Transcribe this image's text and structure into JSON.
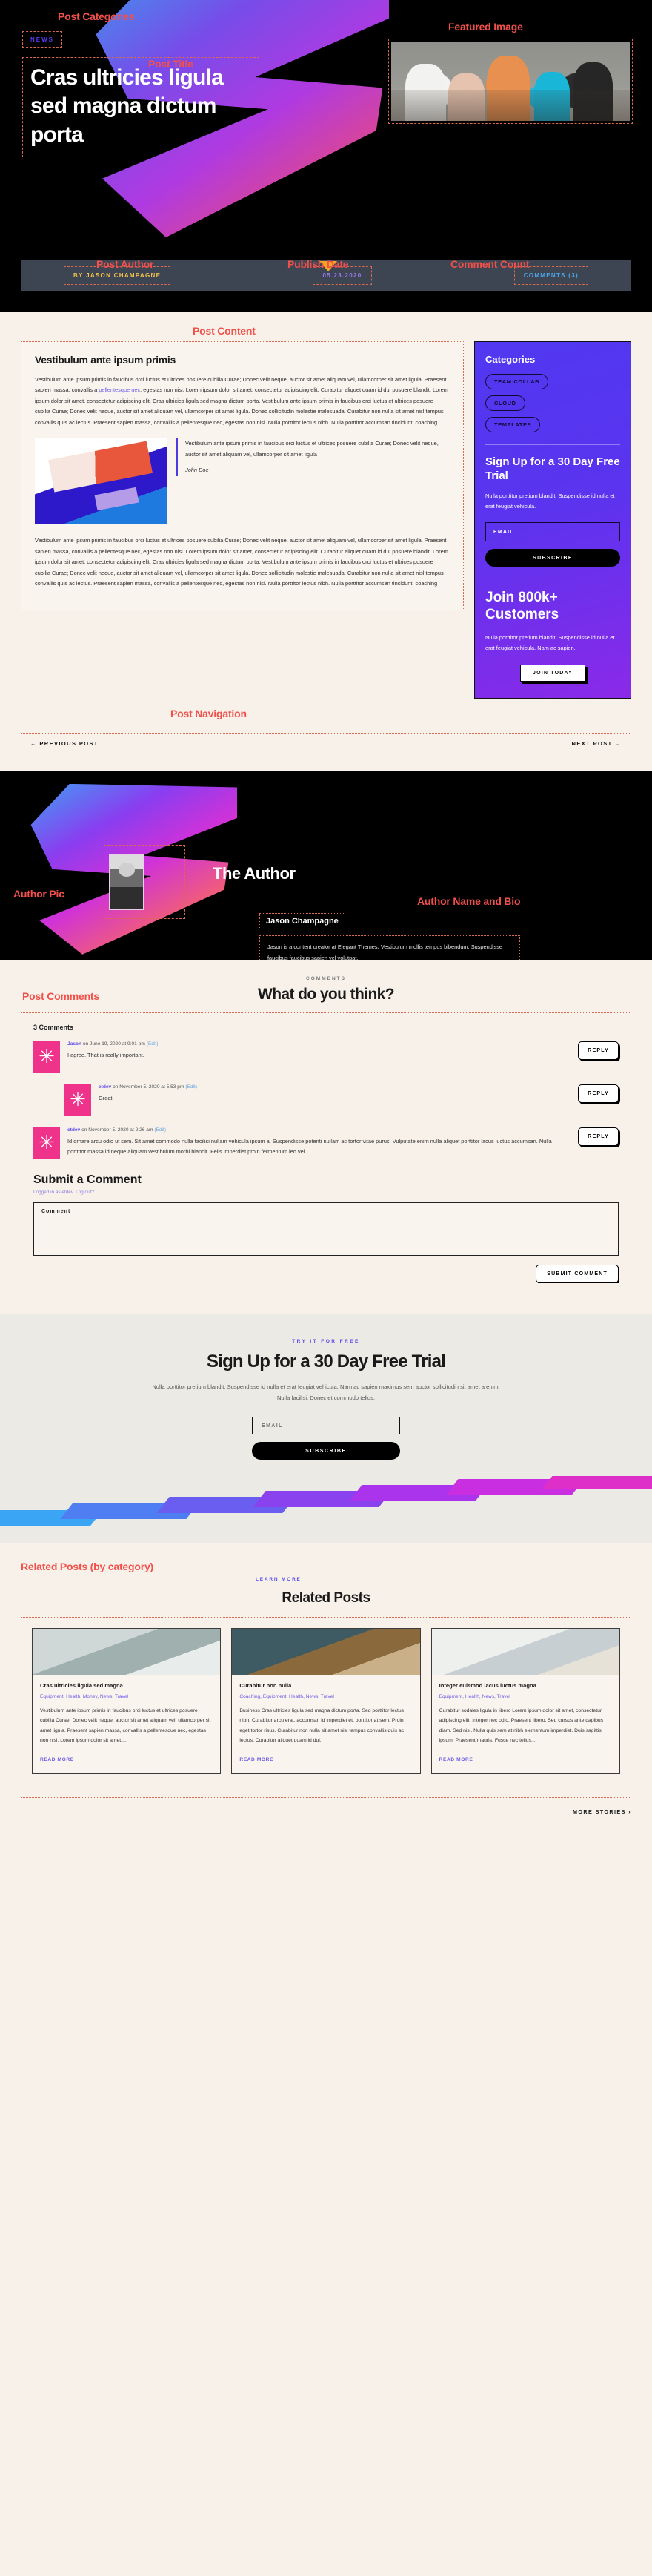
{
  "annotations": {
    "post_categories": "Post Categories",
    "post_title": "Post Title",
    "featured_image": "Featured Image",
    "post_author": "Post Author",
    "publish_date": "Publish Date",
    "comment_count": "Comment Count",
    "post_content": "Post Content",
    "post_navigation": "Post Navigation",
    "author_pic": "Author Pic",
    "author_name_bio": "Author Name and Bio",
    "post_comments": "Post Comments",
    "related_posts": "Related Posts (by category)"
  },
  "hero": {
    "category": "NEWS",
    "title": "Cras ultricies ligula sed magna dictum porta"
  },
  "meta": {
    "author": "BY JASON CHAMPAGNE",
    "date": "05.23.2020",
    "comments": "COMMENTS (3)"
  },
  "post": {
    "heading": "Vestibulum ante ipsum primis",
    "paragraph1_a": "Vestibulum ante ipsum primis in faucibus orci luctus et ultrices posuere cubilia Curae; Donec velit neque, auctor sit amet aliquam vel, ullamcorper sit amet ligula. Praesent sapien massa, convallis a ",
    "paragraph1_link": "pellentesque nec",
    "paragraph1_b": ", egestas non nisi. Lorem ipsum dolor sit amet, consectetur adipiscing elit. Curabitur aliquet quam id dui posuere blandit. Lorem ipsum dolor sit amet, consectetur adipiscing elit. Cras ultricies ligula sed magna dictum porta. Vestibulum ante ipsum primis in faucibus orci luctus et ultrices posuere cubilia Curae; Donec velit neque, auctor sit amet aliquam vel, ullamcorper sit amet ligula. Donec sollicitudin molestie malesuada. Curabitur non nulla sit amet nisl tempus convallis quis ac lectus. Praesent sapien massa, convallis a pellentesque nec, egestas non nisi. Nulla porttitor lectus nibh. Nulla porttitor accumsan tincidunt. coaching",
    "quote": "Vestibulum ante ipsum primis in faucibus orci luctus et ultrices posuere cubilia Curae; Donec velit neque, auctor sit amet aliquam vel, ullamcorper sit amet ligula",
    "quote_author": "John Doe",
    "paragraph2": "Vestibulum ante ipsum primis in faucibus orci luctus et ultrices posuere cubilia Curae; Donec velit neque, auctor sit amet aliquam vel, ullamcorper sit amet ligula. Praesent sapien massa, convallis a pellentesque nec, egestas non nisi. Lorem ipsum dolor sit amet, consectetur adipiscing elit. Curabitur aliquet quam id dui posuere blandit. Lorem ipsum dolor sit amet, consectetur adipiscing elit. Cras ultricies ligula sed magna dictum porta. Vestibulum ante ipsum primis in faucibus orci luctus et ultrices posuere cubilia Curae; Donec velit neque, auctor sit amet aliquam vel, ullamcorper sit amet ligula. Donec sollicitudin molestie malesuada. Curabitur non nulla sit amet nisl tempus convallis quis ac lectus. Praesent sapien massa, convallis a pellentesque nec, egestas non nisi. Nulla porttitor lectus nibh. Nulla porttitor accumsan tincidunt. coaching"
  },
  "sidebar": {
    "categories_title": "Categories",
    "tags": [
      "TEAM COLLAB",
      "CLOUD",
      "TEMPLATES"
    ],
    "signup_title": "Sign Up for a 30 Day Free Trial",
    "signup_text": "Nulla porttitor pretium blandit. Suspendisse id nulla et erat feugiat vehicula.",
    "email_placeholder": "EMAIL",
    "subscribe_label": "SUBSCRIBE",
    "join_title": "Join 800k+ Customers",
    "join_text": "Nulla porttitor pretium blandit. Suspendisse id nulla et erat feugiat vehicula. Nam ac sapien.",
    "join_label": "JOIN TODAY"
  },
  "postnav": {
    "previous": "← PREVIOUS POST",
    "next": "NEXT POST →"
  },
  "author": {
    "heading": "The Author",
    "name": "Jason Champagne",
    "bio": "Jason is a content creator at Elegant Themes. Vestibulum mollis tempus bibendum. Suspendisse faucibus faucibus sapien vel volutpat."
  },
  "comments": {
    "eyebrow": "COMMENTS",
    "heading": "What do you think?",
    "count_label": "3 Comments",
    "items": [
      {
        "name": "Jason",
        "meta": " on June 19, 2020 at 9:01 pm ",
        "edit": "(Edit)",
        "text": "I agree. That is really important.",
        "reply": "REPLY",
        "indent": false
      },
      {
        "name": "etdev",
        "meta": " on November 5, 2020 at 5:53 pm ",
        "edit": "(Edit)",
        "text": "Great!",
        "reply": "REPLY",
        "indent": true
      },
      {
        "name": "etdev",
        "meta": " on November 5, 2020 at 2:26 am ",
        "edit": "(Edit)",
        "text": "Id ornare arcu odio ut sem. Sit amet commodo nulla facilisi nullam vehicula ipsum a. Suspendisse potenti nullam ac tortor vitae purus. Vulputate enim nulla aliquet porttitor lacus luctus accumsan. Nulla porttitor massa id neque aliquam vestibulum morbi blandit. Felis imperdiet proin fermentum leo vel.",
        "reply": "REPLY",
        "indent": false
      }
    ],
    "submit_heading": "Submit a Comment",
    "logged_in": "Logged in as etdev. Log out?",
    "comment_placeholder": "Comment",
    "submit_label": "SUBMIT COMMENT"
  },
  "cta": {
    "eyebrow": "TRY IT FOR FREE",
    "heading": "Sign Up for a 30 Day Free Trial",
    "text": "Nulla porttitor pretium blandit. Suspendisse id nulla et erat feugiat vehicula. Nam ac sapien maximus sem auctor sollicitudin sit amet a enim. Nulla facilisi. Donec et commodo tellus.",
    "email_placeholder": "EMAIL",
    "subscribe_label": "SUBSCRIBE"
  },
  "related": {
    "learn_more": "LEARN MORE",
    "heading": "Related Posts",
    "cards": [
      {
        "title": "Cras ultricies ligula sed magna",
        "categories": "Equipment, Health, Money, News, Travel",
        "text": "Vestibulum ante ipsum primis in faucibus orci luctus et ultrices posuere cubilia Curae; Donec velit neque, auctor sit amet aliquam vel, ullamcorper sit amet ligula. Praesent sapien massa, convallis a pellentesque nec, egestas non nisi. Lorem ipsum dolor sit amet,...",
        "read_more": "READ MORE"
      },
      {
        "title": "Curabitur non nulla",
        "categories": "Coaching, Equipment, Health, News, Travel",
        "text": "Business Cras ultricies ligula sed magna dictum porta. Sed porttitor lectus nibh. Curabitur arcu erat, accumsan id imperdiet et, porttitor at sem. Proin eget tortor risus. Curabitur non nulla sit amet nisl tempus convallis quis ac lectus. Curabitur aliquet quam id dui.",
        "read_more": "READ MORE"
      },
      {
        "title": "Integer euismod lacus luctus magna",
        "categories": "Equipment, Health, News, Travel",
        "text": "Curabitur sodales ligula in libero Lorem ipsum dolor sit amet, consectetur adipiscing elit. Integer nec odio. Praesent libero. Sed cursus ante dapibus diam. Sed nisi. Nulla quis sem at nibh elementum imperdiet. Duis sagittis ipsum. Praesent mauris. Fusce nec tellus...",
        "read_more": "READ MORE"
      }
    ],
    "more_stories": "MORE STORIES  ›"
  }
}
